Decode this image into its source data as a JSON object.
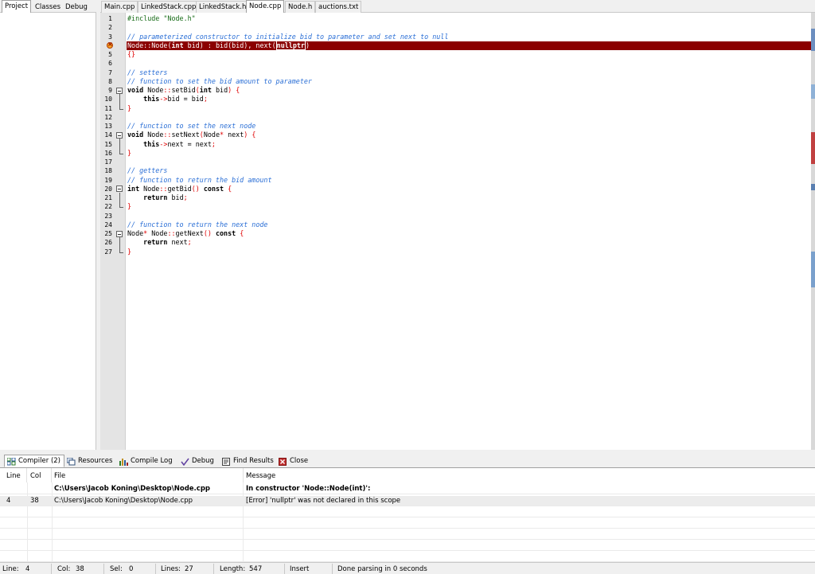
{
  "left_tabs": [
    "Project",
    "Classes",
    "Debug"
  ],
  "editor_tabs": [
    "Main.cpp",
    "LinkedStack.cpp",
    "LinkedStack.h",
    "Node.cpp",
    "Node.h",
    "auctions.txt"
  ],
  "code_lines": [
    "#include \"Node.h\"",
    "",
    "// parameterized constructor to initialize bid to parameter and set next to null",
    "Node::Node(int bid) : bid(bid), next(nullptr)",
    "{}",
    "",
    "// setters",
    "// function to set the bid amount to parameter",
    "void Node::setBid(int bid) {",
    "    this->bid = bid;",
    "}",
    "",
    "// function to set the next node",
    "void Node::setNext(Node* next) {",
    "    this->next = next;",
    "}",
    "",
    "// getters",
    "// function to return the bid amount",
    "int Node::getBid() const {",
    "    return bid;",
    "}",
    "",
    "// function to return the next node",
    "Node* Node::getNext() const {",
    "    return next;",
    "}"
  ],
  "bottom_tabs": [
    "Compiler (2)",
    "Resources",
    "Compile Log",
    "Debug",
    "Find Results",
    "Close"
  ],
  "compiler": {
    "headers": {
      "line": "Line",
      "col": "Col",
      "file": "File",
      "message": "Message"
    },
    "rows": [
      {
        "line": "",
        "col": "",
        "file": "C:\\Users\\Jacob Koning\\Desktop\\Node.cpp",
        "message": "In constructor 'Node::Node(int)':",
        "bold": true
      },
      {
        "line": "4",
        "col": "38",
        "file": "C:\\Users\\Jacob Koning\\Desktop\\Node.cpp",
        "message": "[Error] 'nullptr' was not declared in this scope",
        "bold": false
      }
    ]
  },
  "status": {
    "line_label": "Line:",
    "line_value": "4",
    "col_label": "Col:",
    "col_value": "38",
    "sel_label": "Sel:",
    "sel_value": "0",
    "lines_label": "Lines:",
    "lines_value": "27",
    "length_label": "Length:",
    "length_value": "547",
    "mode": "Insert",
    "message": "Done parsing in 0 seconds"
  },
  "colors": {
    "error_line": "#8b0000",
    "comment": "#2b6fd6",
    "brace": "#e00000"
  }
}
